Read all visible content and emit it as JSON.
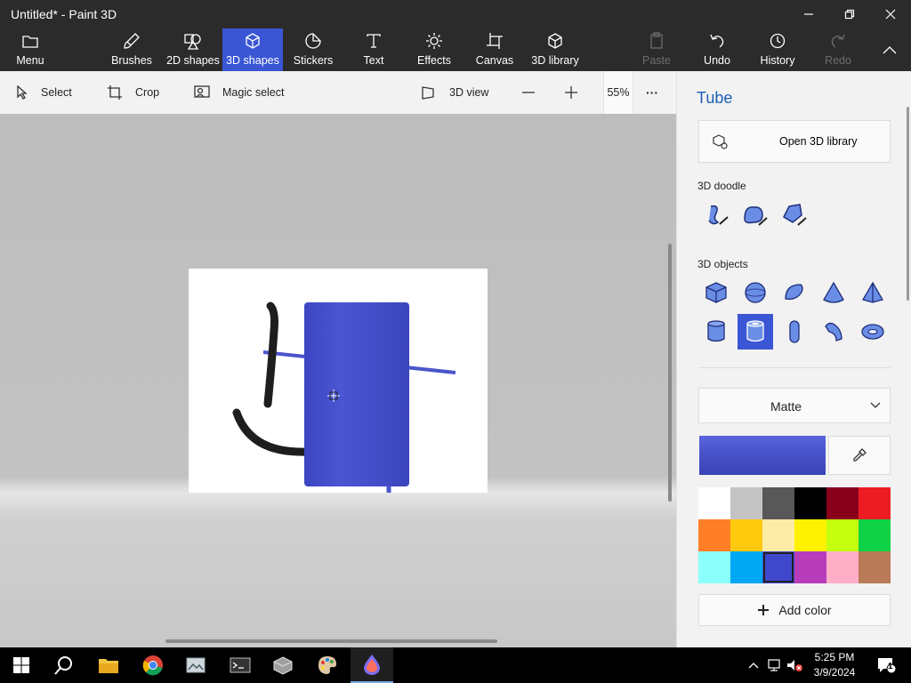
{
  "window": {
    "title": "Untitled* - Paint 3D"
  },
  "ribbon": {
    "menu": "Menu",
    "brushes": "Brushes",
    "shapes2d": "2D shapes",
    "shapes3d": "3D shapes",
    "stickers": "Stickers",
    "text": "Text",
    "effects": "Effects",
    "canvas": "Canvas",
    "library3d": "3D library",
    "paste": "Paste",
    "undo": "Undo",
    "history": "History",
    "redo": "Redo"
  },
  "toolbar": {
    "select": "Select",
    "crop": "Crop",
    "magic_select": "Magic select",
    "view3d": "3D view",
    "zoom": "55%",
    "more": "···"
  },
  "panel": {
    "title": "Tube",
    "open_library": "Open 3D library",
    "doodle_label": "3D doodle",
    "objects_label": "3D objects",
    "material": "Matte",
    "add_color": "Add color",
    "current_color": "#4a55cc",
    "palette": [
      "#ffffff",
      "#c3c3c3",
      "#585858",
      "#000000",
      "#88001b",
      "#ec1c24",
      "#ff7f27",
      "#ffc90e",
      "#fdeca6",
      "#fff200",
      "#c4ff0e",
      "#0ed145",
      "#8cfffb",
      "#00a8f3",
      "#3f48cc",
      "#b83dba",
      "#ffaec8",
      "#b97a57"
    ],
    "selected_swatch": 14
  },
  "scene": {
    "tube_color": "#4a55cc",
    "stroke_color": "#1e1e1e"
  },
  "taskbar": {
    "time": "5:25 PM",
    "date": "3/9/2024",
    "notification_count": "1"
  }
}
